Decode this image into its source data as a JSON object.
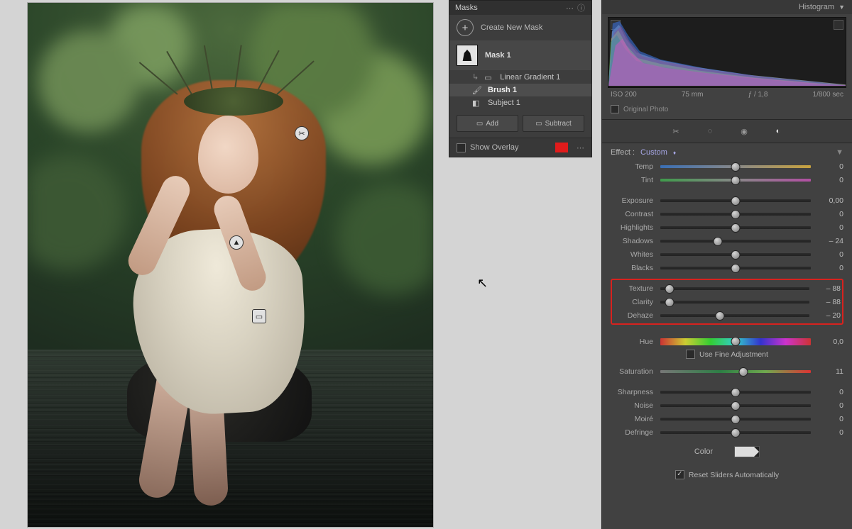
{
  "masks_panel": {
    "title": "Masks",
    "create_label": "Create New Mask",
    "mask_name": "Mask 1",
    "components": [
      {
        "icon": "gradient",
        "label": "Linear Gradient 1"
      },
      {
        "icon": "brush",
        "label": "Brush 1"
      },
      {
        "icon": "subject",
        "label": "Subject 1"
      }
    ],
    "add_label": "Add",
    "subtract_label": "Subtract",
    "overlay_label": "Show Overlay",
    "overlay_color": "#e11b1b"
  },
  "histogram": {
    "title": "Histogram",
    "iso": "ISO 200",
    "focal": "75 mm",
    "aperture": "ƒ / 1,8",
    "shutter": "1/800 sec",
    "original_label": "Original Photo"
  },
  "effect": {
    "label": "Effect :",
    "preset": "Custom"
  },
  "sliders": {
    "temp": {
      "label": "Temp",
      "value": "0",
      "pos": 50,
      "track": "temp"
    },
    "tint": {
      "label": "Tint",
      "value": "0",
      "pos": 50,
      "track": "tint"
    },
    "exposure": {
      "label": "Exposure",
      "value": "0,00",
      "pos": 50
    },
    "contrast": {
      "label": "Contrast",
      "value": "0",
      "pos": 50
    },
    "highlights": {
      "label": "Highlights",
      "value": "0",
      "pos": 50
    },
    "shadows": {
      "label": "Shadows",
      "value": "– 24",
      "pos": 38
    },
    "whites": {
      "label": "Whites",
      "value": "0",
      "pos": 50
    },
    "blacks": {
      "label": "Blacks",
      "value": "0",
      "pos": 50
    },
    "texture": {
      "label": "Texture",
      "value": "– 88",
      "pos": 6
    },
    "clarity": {
      "label": "Clarity",
      "value": "– 88",
      "pos": 6
    },
    "dehaze": {
      "label": "Dehaze",
      "value": "– 20",
      "pos": 40
    },
    "hue": {
      "label": "Hue",
      "value": "0,0",
      "pos": 50,
      "track": "hue"
    },
    "fine_label": "Use Fine Adjustment",
    "saturation": {
      "label": "Saturation",
      "value": "11",
      "pos": 55,
      "track": "sat"
    },
    "sharpness": {
      "label": "Sharpness",
      "value": "0",
      "pos": 50
    },
    "noise": {
      "label": "Noise",
      "value": "0",
      "pos": 50
    },
    "moire": {
      "label": "Moiré",
      "value": "0",
      "pos": 50
    },
    "defringe": {
      "label": "Defringe",
      "value": "0",
      "pos": 50
    }
  },
  "color_label": "Color",
  "reset_label": "Reset Sliders Automatically"
}
